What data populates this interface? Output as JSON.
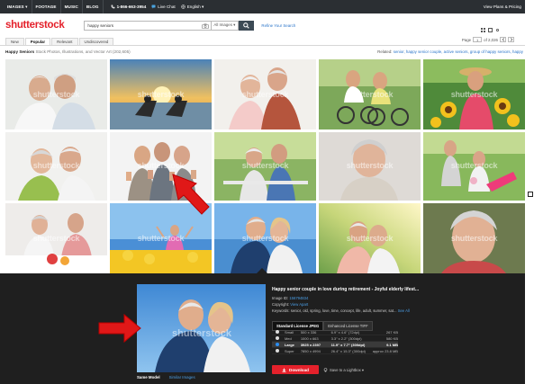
{
  "topbar": {
    "nav": [
      "IMAGES ▾",
      "FOOTAGE",
      "MUSIC",
      "BLOG"
    ],
    "phone": "1-866-663-3954",
    "chat": "Live Chat",
    "language": "English ▾",
    "account": "View Plans & Pricing"
  },
  "header": {
    "logo": "shutterstock",
    "search_value": "happy seniors",
    "search_type": "All Images ▾",
    "refine_label": "Refine Your Search"
  },
  "tabs": {
    "items": [
      "New",
      "Popular",
      "Relevant",
      "Undiscovered"
    ],
    "active_index": 1,
    "page_label": "Page",
    "page_value": "1",
    "page_of": "of 2,026"
  },
  "results": {
    "title": "Happy Seniors",
    "subtitle": "Stock Photos, Illustrations, and Vector Art (202,605)",
    "related_label": "Related:",
    "related_links": "senior, happy senior couple, active seniors, group of happy seniors, happy",
    "watermark": "shutterstock"
  },
  "detail": {
    "title": "Happy senior couple in love during retirement - Joyful elderly lifest...",
    "image_id_label": "Image ID:",
    "image_id": "156794834",
    "copyright_label": "Copyright:",
    "copyright": "View Apart",
    "keywords_label": "Keywords:",
    "keywords": "senior, old, spring, love, time, concept, life, adult, summer, sat...",
    "see_all": "See All",
    "license_tabs": [
      "Standard License JPEG",
      "Enhanced License TIFF"
    ],
    "sizes": [
      {
        "name": "Small",
        "dims": "500 x 336",
        "inches": "6.9\" x 4.6\" (72dpi)",
        "size": "267 KB"
      },
      {
        "name": "Med",
        "dims": "1000 x 663",
        "inches": "3.3\" x 2.2\" (300dpi)",
        "size": "580 KB"
      },
      {
        "name": "Large",
        "dims": "3925 x 2397",
        "inches": "11.9\" x 7.7\" (300dpi)",
        "size": "9.1 MB"
      },
      {
        "name": "Super",
        "dims": "7850 x 4994",
        "inches": "26.4\" x 15.3\" (300dpi)",
        "size": "approx 23.8 MB"
      }
    ],
    "selected_size_index": 2,
    "download_label": "Download",
    "lightbox_label": "Save to a Lightbox ▾",
    "bottom_tabs": [
      "Same Model",
      "Similar Images"
    ]
  }
}
